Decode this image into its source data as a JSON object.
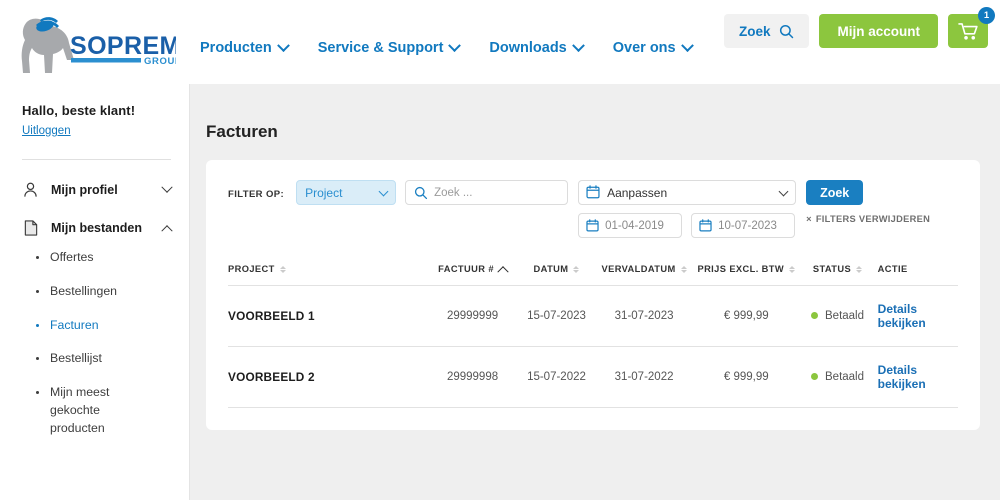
{
  "header": {
    "logo": {
      "name": "SOPREMA",
      "sub": "GROUP"
    },
    "nav": [
      {
        "label": "Producten",
        "icon": "chevron-down-icon"
      },
      {
        "label": "Service & Support",
        "icon": "chevron-down-icon"
      },
      {
        "label": "Downloads",
        "icon": "chevron-down-icon"
      },
      {
        "label": "Over ons",
        "icon": "chevron-down-icon"
      }
    ],
    "search_button": {
      "label": "Zoek",
      "icon": "search-icon"
    },
    "account_button": {
      "label": "Mijn account"
    },
    "cart": {
      "icon": "shopping-cart-icon",
      "badge": "1"
    }
  },
  "sidebar": {
    "greeting": "Hallo, beste klant!",
    "logout": "Uitloggen",
    "groups": [
      {
        "label": "Mijn profiel",
        "icon": "user-icon",
        "state": "collapsed"
      },
      {
        "label": "Mijn bestanden",
        "icon": "document-icon",
        "state": "expanded"
      }
    ],
    "items": [
      {
        "label": "Offertes",
        "active": false
      },
      {
        "label": "Bestellingen",
        "active": false
      },
      {
        "label": "Facturen",
        "active": true
      },
      {
        "label": "Bestellijst",
        "active": false
      },
      {
        "label": "Mijn meest gekochte producten",
        "active": false
      }
    ]
  },
  "main": {
    "title": "Facturen",
    "filters": {
      "label": "FILTER OP:",
      "select_value": "Project",
      "select_options": [
        "Project"
      ],
      "search_placeholder": "Zoek ...",
      "search_value": "",
      "range_value": "Aanpassen",
      "range_options": [
        "Aanpassen"
      ],
      "date_from": "01-04-2019",
      "date_to": "10-07-2023",
      "search_button": "Zoek",
      "clear_filters": "FILTERS VERWIJDEREN"
    },
    "table": {
      "columns": [
        {
          "label": "PROJECT",
          "sort": "none"
        },
        {
          "label": "FACTUUR #",
          "sort": "asc"
        },
        {
          "label": "DATUM",
          "sort": "none"
        },
        {
          "label": "VERVALDATUM",
          "sort": "none"
        },
        {
          "label": "PRIJS EXCL. BTW",
          "sort": "none"
        },
        {
          "label": "STATUS",
          "sort": "none"
        },
        {
          "label": "ACTIE",
          "sort": "off"
        }
      ],
      "rows": [
        {
          "project": "VOORBEELD 1",
          "invoice": "29999999",
          "date": "15-07-2023",
          "due": "31-07-2023",
          "price": "€ 999,99",
          "status": "Betaald",
          "action": "Details bekijken"
        },
        {
          "project": "VOORBEELD 2",
          "invoice": "29999998",
          "date": "15-07-2022",
          "due": "31-07-2022",
          "price": "€ 999,99",
          "status": "Betaald",
          "action": "Details bekijken"
        }
      ]
    }
  },
  "colors": {
    "brand_blue": "#1179bf",
    "brand_green": "#8cc63e",
    "accent_blue": "#1a7fc1",
    "status_paid": "#8cc63e",
    "page_bg": "#efefef"
  }
}
